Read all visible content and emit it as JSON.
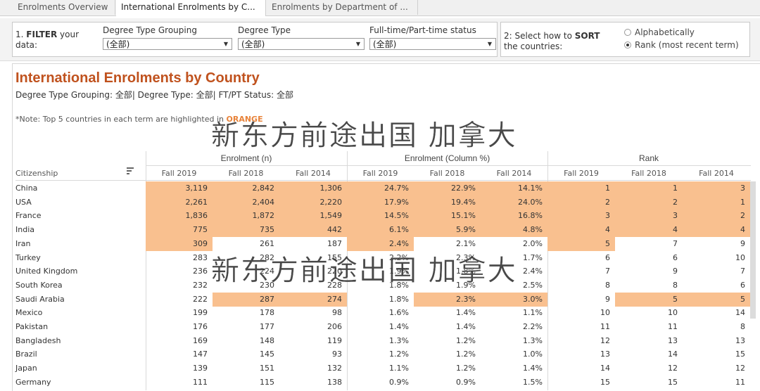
{
  "tabs": [
    {
      "label": "Enrolments Overview",
      "active": false
    },
    {
      "label": "International Enrolments by C...",
      "active": true
    },
    {
      "label": "Enrolments by Department of ...",
      "active": false
    }
  ],
  "filters": {
    "step_label_prefix": "1.",
    "step_label_bold": "FILTER",
    "step_label_rest": " your",
    "step_label_line2": "data:",
    "groups": [
      {
        "title": "Degree Type Grouping",
        "value": "(全部)"
      },
      {
        "title": "Degree Type",
        "value": "(全部)"
      },
      {
        "title": "Full-time/Part-time status",
        "value": "(全部)"
      }
    ]
  },
  "sort": {
    "label_line1": "2: Select how to ",
    "label_bold": "SORT",
    "label_line2": "the countries:",
    "options": [
      {
        "label": "Alphabetically",
        "selected": false
      },
      {
        "label": "Rank (most recent term)",
        "selected": true
      }
    ]
  },
  "report": {
    "title": "International Enrolments by Country",
    "subtitle": "Degree Type Grouping: 全部| Degree Type: 全部| FT/PT Status: 全部",
    "note_prefix": "*Note: Top 5 countries in each term are highlighted in ",
    "note_highlight": "ORANGE",
    "highlight_color": "#f9c08f",
    "title_color": "#c0521e"
  },
  "watermarks": [
    "新东方前途出国 加拿大",
    "新东方前途出国 加拿大"
  ],
  "table": {
    "citizenship_header": "Citizenship",
    "group_headers": [
      "Enrolment (n)",
      "Enrolment (Column %)",
      "Rank"
    ],
    "column_headers": [
      "Fall 2019",
      "Fall 2018",
      "Fall 2014",
      "Fall 2019",
      "Fall 2018",
      "Fall 2014",
      "Fall 2019",
      "Fall 2018",
      "Fall 2014"
    ],
    "rows": [
      {
        "name": "China",
        "cells": [
          "3,119",
          "2,842",
          "1,306",
          "24.7%",
          "22.9%",
          "14.1%",
          "1",
          "1",
          "3"
        ],
        "hl": [
          1,
          1,
          1,
          1,
          1,
          1,
          1,
          1,
          1
        ]
      },
      {
        "name": "USA",
        "cells": [
          "2,261",
          "2,404",
          "2,220",
          "17.9%",
          "19.4%",
          "24.0%",
          "2",
          "2",
          "1"
        ],
        "hl": [
          1,
          1,
          1,
          1,
          1,
          1,
          1,
          1,
          1
        ]
      },
      {
        "name": "France",
        "cells": [
          "1,836",
          "1,872",
          "1,549",
          "14.5%",
          "15.1%",
          "16.8%",
          "3",
          "3",
          "2"
        ],
        "hl": [
          1,
          1,
          1,
          1,
          1,
          1,
          1,
          1,
          1
        ]
      },
      {
        "name": "India",
        "cells": [
          "775",
          "735",
          "442",
          "6.1%",
          "5.9%",
          "4.8%",
          "4",
          "4",
          "4"
        ],
        "hl": [
          1,
          1,
          1,
          1,
          1,
          1,
          1,
          1,
          1
        ]
      },
      {
        "name": "Iran",
        "cells": [
          "309",
          "261",
          "187",
          "2.4%",
          "2.1%",
          "2.0%",
          "5",
          "7",
          "9"
        ],
        "hl": [
          1,
          0,
          0,
          1,
          0,
          0,
          1,
          0,
          0
        ]
      },
      {
        "name": "Turkey",
        "cells": [
          "283",
          "282",
          "155",
          "2.2%",
          "2.3%",
          "1.7%",
          "6",
          "6",
          "10"
        ],
        "hl": [
          0,
          0,
          0,
          0,
          0,
          0,
          0,
          0,
          0
        ]
      },
      {
        "name": "United Kingdom",
        "cells": [
          "236",
          "224",
          "220",
          "1.9%",
          "1.8%",
          "2.4%",
          "7",
          "9",
          "7"
        ],
        "hl": [
          0,
          0,
          0,
          0,
          0,
          0,
          0,
          0,
          0
        ]
      },
      {
        "name": "South Korea",
        "cells": [
          "232",
          "230",
          "228",
          "1.8%",
          "1.9%",
          "2.5%",
          "8",
          "8",
          "6"
        ],
        "hl": [
          0,
          0,
          0,
          0,
          0,
          0,
          0,
          0,
          0
        ]
      },
      {
        "name": "Saudi Arabia",
        "cells": [
          "222",
          "287",
          "274",
          "1.8%",
          "2.3%",
          "3.0%",
          "9",
          "5",
          "5"
        ],
        "hl": [
          0,
          1,
          1,
          0,
          1,
          1,
          0,
          1,
          1
        ]
      },
      {
        "name": "Mexico",
        "cells": [
          "199",
          "178",
          "98",
          "1.6%",
          "1.4%",
          "1.1%",
          "10",
          "10",
          "14"
        ],
        "hl": [
          0,
          0,
          0,
          0,
          0,
          0,
          0,
          0,
          0
        ]
      },
      {
        "name": "Pakistan",
        "cells": [
          "176",
          "177",
          "206",
          "1.4%",
          "1.4%",
          "2.2%",
          "11",
          "11",
          "8"
        ],
        "hl": [
          0,
          0,
          0,
          0,
          0,
          0,
          0,
          0,
          0
        ]
      },
      {
        "name": "Bangladesh",
        "cells": [
          "169",
          "148",
          "119",
          "1.3%",
          "1.2%",
          "1.3%",
          "12",
          "13",
          "13"
        ],
        "hl": [
          0,
          0,
          0,
          0,
          0,
          0,
          0,
          0,
          0
        ]
      },
      {
        "name": "Brazil",
        "cells": [
          "147",
          "145",
          "93",
          "1.2%",
          "1.2%",
          "1.0%",
          "13",
          "14",
          "15"
        ],
        "hl": [
          0,
          0,
          0,
          0,
          0,
          0,
          0,
          0,
          0
        ]
      },
      {
        "name": "Japan",
        "cells": [
          "139",
          "151",
          "132",
          "1.1%",
          "1.2%",
          "1.4%",
          "14",
          "12",
          "12"
        ],
        "hl": [
          0,
          0,
          0,
          0,
          0,
          0,
          0,
          0,
          0
        ]
      },
      {
        "name": "Germany",
        "cells": [
          "111",
          "115",
          "138",
          "0.9%",
          "0.9%",
          "1.5%",
          "15",
          "15",
          "11"
        ],
        "hl": [
          0,
          0,
          0,
          0,
          0,
          0,
          0,
          0,
          0
        ]
      }
    ]
  }
}
